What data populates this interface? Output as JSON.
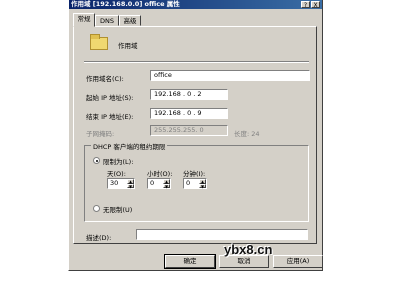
{
  "window": {
    "title": "作用域 [192.168.0.0] office 属性",
    "help_glyph": "?",
    "close_glyph": "X"
  },
  "tabs": [
    "常规",
    "DNS",
    "高级"
  ],
  "scope_header": {
    "icon": "folder-icon",
    "label": "作用域"
  },
  "fields": {
    "scope_name_label": "作用域名(C):",
    "scope_name_value": "office",
    "start_ip_label": "起始 IP 地址(S):",
    "start_ip_value": "192.168 . 0 . 2",
    "end_ip_label": "结束 IP 地址(E):",
    "end_ip_value": "192.168 . 0 . 9",
    "subnet_label": "子网掩码:",
    "subnet_value": "255.255.255. 0",
    "length_label": "长度: 24"
  },
  "lease": {
    "group_title": "DHCP 客户端的租约期限",
    "limited_label": "限制为(L):",
    "days_label": "天(O):",
    "hours_label": "小时(O):",
    "minutes_label": "分钟(I):",
    "days_value": "30",
    "hours_value": "0",
    "minutes_value": "0",
    "unlimited_label": "无限制(U)"
  },
  "description": {
    "label": "描述(D):",
    "value": ""
  },
  "buttons": {
    "ok": "确定",
    "cancel": "取消",
    "apply": "应用(A)"
  },
  "watermark": "ybx8.cn"
}
